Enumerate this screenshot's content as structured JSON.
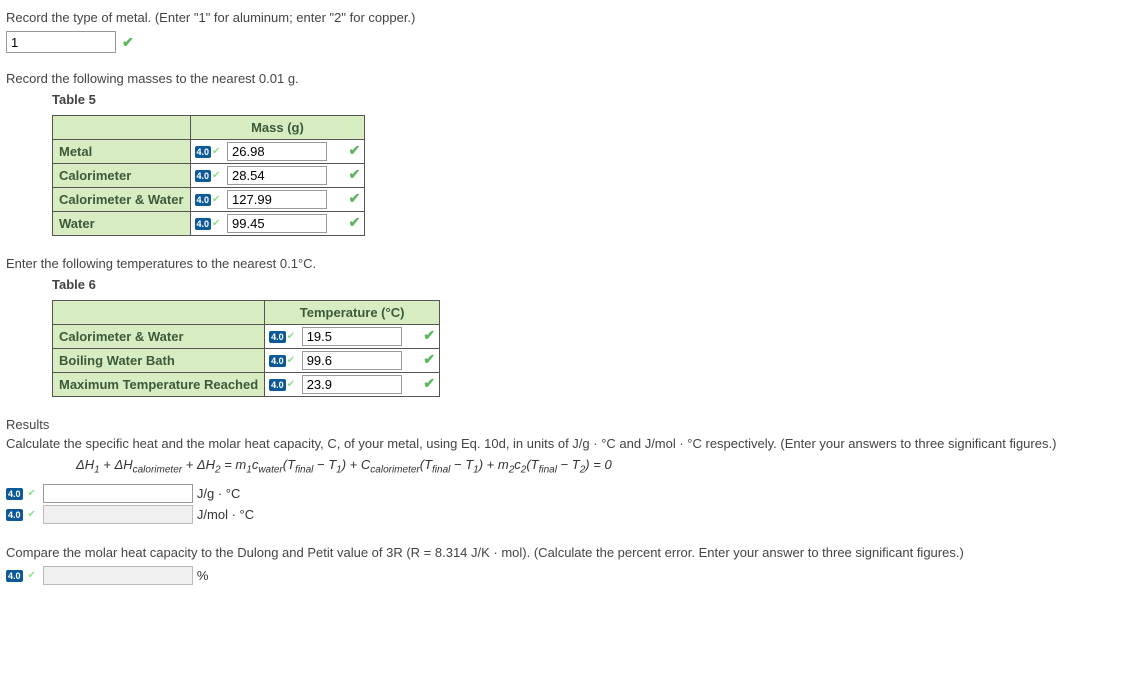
{
  "q1": {
    "instruction": "Record the type of metal. (Enter \"1\" for aluminum; enter \"2\" for copper.)",
    "value": "1"
  },
  "q2": {
    "instruction": "Record the following masses to the nearest 0.01 g.",
    "table_title": "Table 5",
    "header": "Mass (g)",
    "rows": [
      {
        "label": "Metal",
        "value": "26.98"
      },
      {
        "label": "Calorimeter",
        "value": "28.54"
      },
      {
        "label": "Calorimeter & Water",
        "value": "127.99"
      },
      {
        "label": "Water",
        "value": "99.45"
      }
    ],
    "badge": "4.0"
  },
  "q3": {
    "instruction": "Enter the following temperatures to the nearest 0.1°C.",
    "table_title": "Table 6",
    "header": "Temperature (°C)",
    "rows": [
      {
        "label": "Calorimeter & Water",
        "value": "19.5"
      },
      {
        "label": "Boiling Water Bath",
        "value": "99.6"
      },
      {
        "label": "Maximum Temperature Reached",
        "value": "23.9"
      }
    ],
    "badge": "4.0"
  },
  "results": {
    "heading": "Results",
    "instruction": "Calculate the specific heat and the molar heat capacity, C, of your metal, using Eq. 10d, in units of J/g · °C and J/mol · °C respectively. (Enter your answers to three significant figures.)",
    "unit1": "J/g · °C",
    "unit2": "J/mol · °C",
    "badge": "4.0"
  },
  "compare": {
    "instruction": "Compare the molar heat capacity to the Dulong and Petit value of 3R (R = 8.314 J/K · mol). (Calculate the percent error. Enter your answer to three significant figures.)",
    "unit": "%",
    "badge": "4.0"
  }
}
